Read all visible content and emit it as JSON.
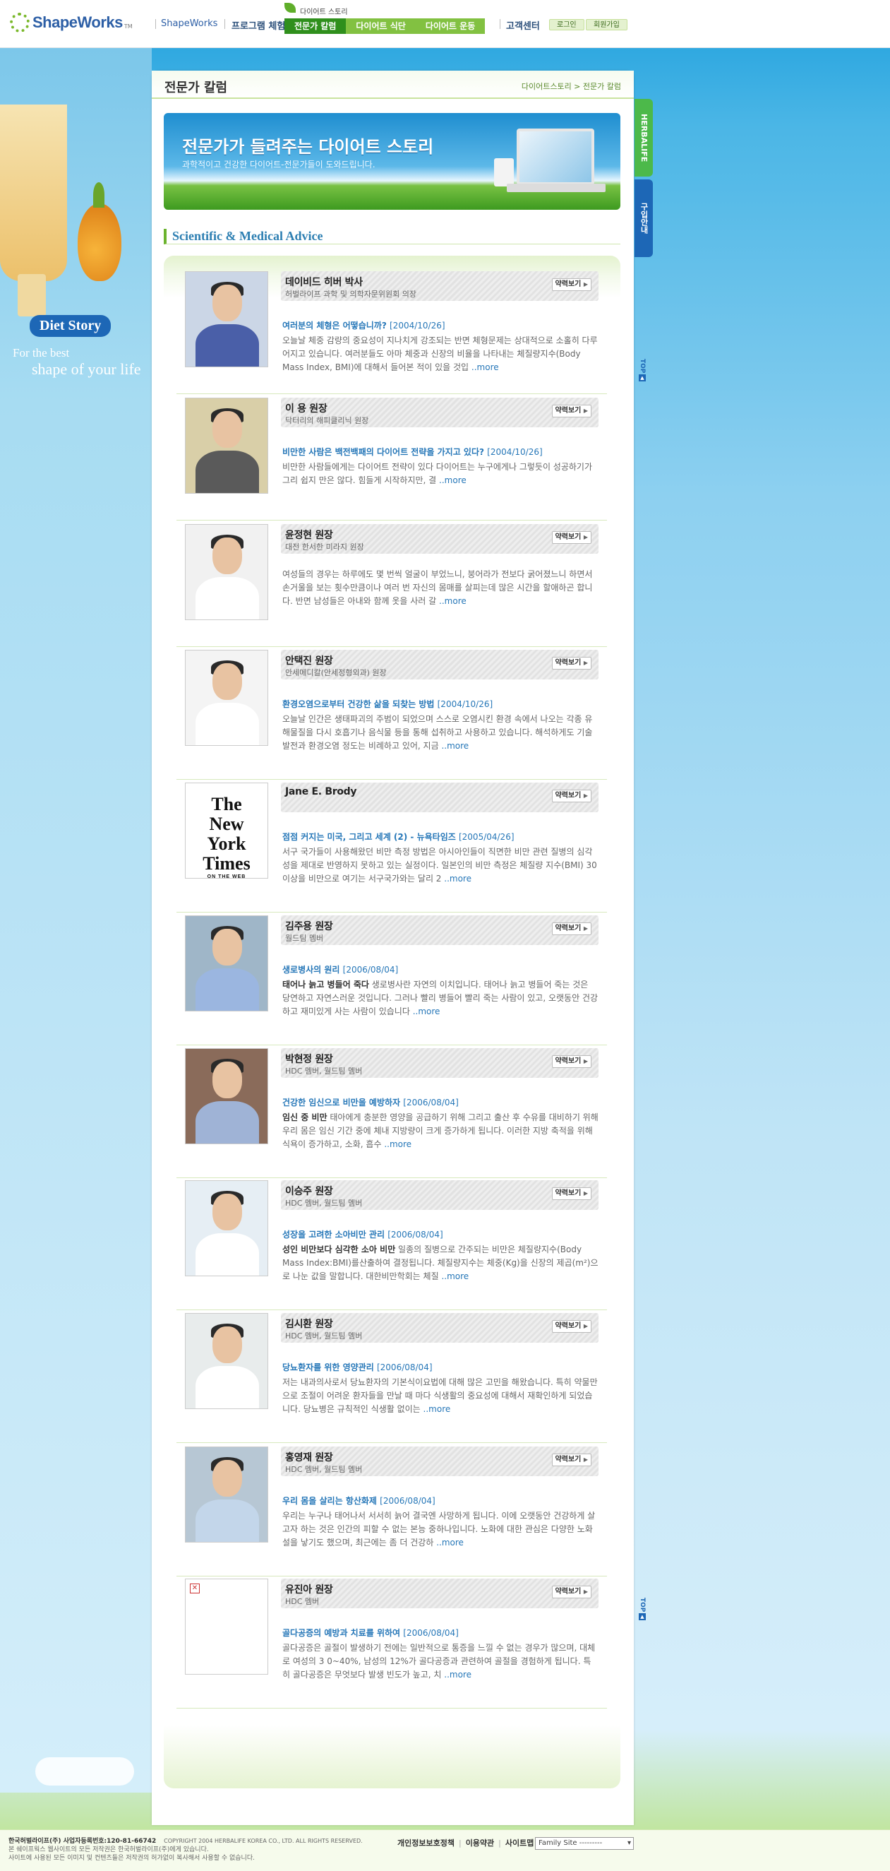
{
  "header": {
    "logo": "ShapeWorks",
    "logo_tm": "TM",
    "nav": [
      "ShapeWorks",
      "프로그램 체험"
    ],
    "diet_menu": "다이어트 스토리",
    "diet_subs": [
      "전문가 칼럼",
      "다이어트 식단",
      "다이어트 운동"
    ],
    "cs": "고객센터",
    "login": "로그인",
    "join": "회원가입"
  },
  "sidebar": {
    "diet_story": "Diet Story",
    "tagline1": "For the best",
    "tagline2": "shape of your life"
  },
  "page": {
    "title": "전문가 칼럼",
    "breadcrumb": "다이어트스토리 > 전문가 칼럼",
    "banner_title": "전문가가 들려주는 다이어트 스토리",
    "banner_sub": "과학적이고 건강한 다이어트-전문가들이 도와드립니다.",
    "section_title": "Scientific & Medical Advice",
    "profile_button": "약력보기",
    "more": "..more"
  },
  "side_tabs": {
    "herbalife": "HERBALIFE",
    "shop": "구입안내",
    "top": "TOP"
  },
  "experts": [
    {
      "name": "데이비드 히버 박사",
      "role": "허벌라이프 과학 및 의학자문위원회 의장",
      "title": "여러분의 체형은 어떻습니까?",
      "date": "[2004/10/26]",
      "lead": "",
      "body": "오늘날 체중 감량의 중요성이 지나치게 강조되는 반면 체형문제는 상대적으로 소홀히 다루어지고 있습니다. 여러분들도 아마 체중과 신장의 비율을 나타내는 체질량지수(Body Mass Index, BMI)에 대해서 들어본 적이 있을 것입"
    },
    {
      "name": "이 용 원장",
      "role": "닥터리의 해피클리닉 원장",
      "title": "비만한 사람은 백전백패의 다이어트 전략을 가지고 있다?",
      "date": "[2004/10/26]",
      "lead": "",
      "body": "비만한 사람들에게는 다이어트 전략이 있다 다이어트는 누구에게나 그렇듯이 성공하기가 그리 쉽지 만은 않다. 힘들게 시작하지만, 결"
    },
    {
      "name": "윤정현 원장",
      "role": "대전 한서한 미라지 원장",
      "title": "",
      "date": "",
      "lead": "",
      "body": "여성들의 경우는 하루에도 몇 번씩 얼굴이 부었느니, 붕어라가 전보다 굵어졌느니 하면서 손거울을 보는 횟수만큼이나 여러 번 자신의 몸매를 살피는데 많은 시간을 할애하곤 합니다. 반면 남성들은 아내와 함께 옷을 사러 갈"
    },
    {
      "name": "안택진 원장",
      "role": "안세메디칼(안세정형외과) 원장",
      "title": "환경오염으로부터 건강한 삶을 되찾는 방법",
      "date": "[2004/10/26]",
      "lead": "",
      "body": "오늘날 인간은 생태파괴의 주범이 되었으며 스스로 오염시킨 환경 속에서 나오는 각종 유해물질을 다시 호흡기나 음식물 등을 통해 섭취하고 사용하고 있습니다. 해석하게도 기술 발전과 환경오염 정도는 비례하고 있어, 지금"
    },
    {
      "name": "Jane E. Brody",
      "role": "",
      "title": "점점 커지는 미국, 그리고 세계 (2) - 뉴욕타임즈",
      "date": "[2005/04/26]",
      "lead": "",
      "body": "서구 국가들이 사용해왔던 비만 측정 방법은 아시아인들이 직면한 비만 관련 질병의 심각성을 제대로 반영하지 못하고 있는 실정이다. 일본인의 비만 측정은 체질량 지수(BMI) 30이상을 비만으로 여기는 서구국가와는 달리 2"
    },
    {
      "name": "김주용 원장",
      "role": "월드팀 멤버",
      "title": "생로병사의 원리",
      "date": "[2006/08/04]",
      "lead": "태어나 늙고 병들어 죽다",
      "body": " 생로병사란 자연의 이치입니다. 태어나 늙고 병들어 죽는 것은 당연하고 자연스러운 것입니다. 그러나 빨리 병들어 빨리 죽는 사람이 있고, 오랫동안 건강하고 재미있게 사는 사람이 있습니다"
    },
    {
      "name": "박현정 원장",
      "role": "HDC 멤버, 월드팀 멤버",
      "title": "건강한 임신으로 비만을 예방하자",
      "date": "[2006/08/04]",
      "lead": "임신 중 비만",
      "body": " 태아에게 충분한 영양을 공급하기 위해 그리고 출산 후 수유를 대비하기 위해 우리 몸은 임신 기간 중에 체내 지방량이 크게 증가하게 됩니다. 이러한 지방 축적을 위해 식욕이 증가하고, 소화, 흡수"
    },
    {
      "name": "이승주 원장",
      "role": "HDC 멤버, 월드팀 멤버",
      "title": "성장을 고려한 소아비만 관리",
      "date": "[2006/08/04]",
      "lead": "성인 비만보다 심각한 소아 비만",
      "body": " 일종의 질병으로 간주되는 비만은 체질량지수(Body Mass Index:BMI)를산출하여 결정됩니다. 체질량지수는 체중(Kg)을 신장의 제곱(m²)으로 나눈 값을 말합니다. 대한비만학회는 체질"
    },
    {
      "name": "김시환 원장",
      "role": "HDC 멤버, 월드팀 멤버",
      "title": "당뇨환자를 위한 영양관리",
      "date": "[2006/08/04]",
      "lead": "",
      "body": "저는 내과의사로서 당뇨환자의 기본식이요법에 대해 많은 고민을 해왔습니다. 특히 약물만으로 조절이 어려운 환자들을 만날 때 마다 식생활의 중요성에 대해서 재확인하게 되었습니다. 당뇨병은 규칙적인 식생활 없이는"
    },
    {
      "name": "홍영재 원장",
      "role": "HDC 멤버, 월드팀 멤버",
      "title": "우리 몸을 살리는 항산화제",
      "date": "[2006/08/04]",
      "lead": "",
      "body": "우리는 누구나 태어나서 서서히 늙어 결국엔 사망하게 됩니다. 이에 오랫동안 건강하게 살고자 하는 것은 인간의 피할 수 없는 본능 중하나입니다. 노화에 대한 관심은 다양한 노화설을 낳기도 했으며, 최근에는 좀 더 건강하"
    },
    {
      "name": "유진아 원장",
      "role": "HDC 멤버",
      "title": "골다공증의 예방과 치료를 위하여",
      "date": "[2006/08/04]",
      "lead": "",
      "body": "골다공증은 골절이 발생하기 전에는 일반적으로 통증을 느낄 수 없는 경우가 많으며, 대체로 여성의 3 0~40%, 남성의 12%가 골다공증과 관련하여 골절을 경험하게 됩니다. 특히 골다공증은 무엇보다 발생 빈도가 높고, 치"
    }
  ],
  "footer": {
    "company": "한국허벌라이프(주) 사업자등록번호:120-81-66742",
    "copyright": "COPYRIGHT 2004 HERBALIFE KOREA CO., LTD. ALL RIGHTS RESERVED.",
    "line2": "본 쉐이프웍스 웹사이트의 모든 저작권은 한국허벌라이프(주)에게 있습니다.",
    "line3": "사이트에 사용된 모든 이미지 및 컨텐츠들은 저작권의 허가없이 복사해서 사용할 수 없습니다.",
    "links": [
      "개인정보보호정책",
      "이용약관",
      "사이트맵"
    ],
    "family_site": "Family Site ---------"
  }
}
